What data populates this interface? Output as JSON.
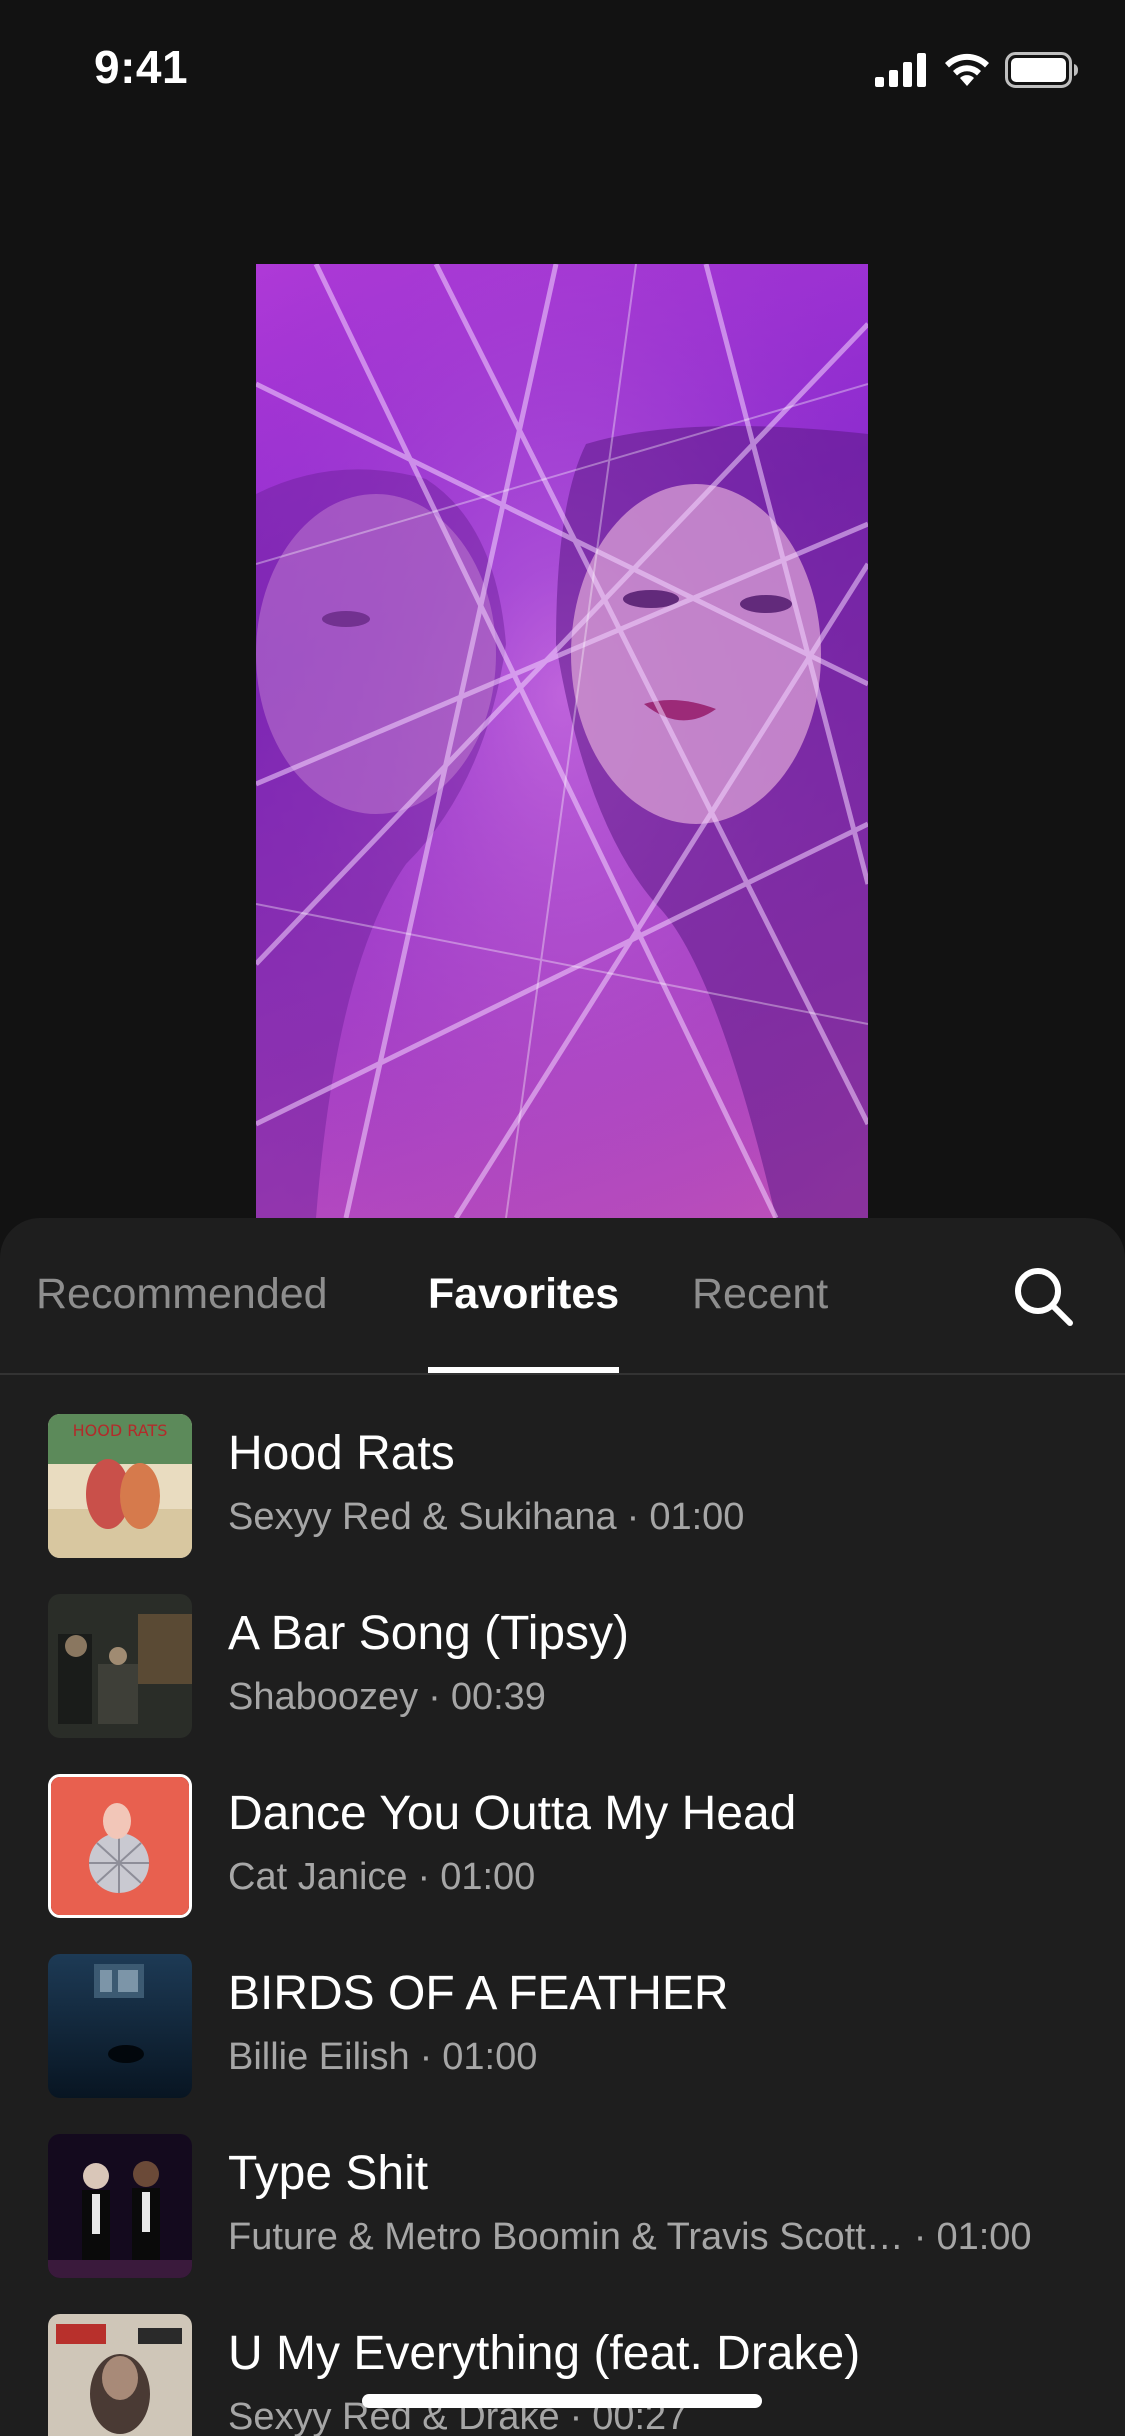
{
  "status_bar": {
    "time": "9:41",
    "icons": [
      "cellular-signal-icon",
      "wifi-icon",
      "battery-icon"
    ]
  },
  "preview": {
    "accent": "#a23ad6"
  },
  "tabs": [
    {
      "label": "Recommended",
      "active": false
    },
    {
      "label": "Favorites",
      "active": true
    },
    {
      "label": "Recent",
      "active": false
    }
  ],
  "search": {
    "icon": "search-icon"
  },
  "songs": [
    {
      "title": "Hood Rats",
      "artist": "Sexyy Red & Sukihana",
      "duration": "01:00"
    },
    {
      "title": "A Bar Song (Tipsy)",
      "artist": "Shaboozey",
      "duration": "00:39"
    },
    {
      "title": "Dance You Outta My Head",
      "artist": "Cat Janice",
      "duration": "01:00"
    },
    {
      "title": "BIRDS OF A FEATHER",
      "artist": "Billie Eilish",
      "duration": "01:00"
    },
    {
      "title": "Type Shit",
      "artist": "Future & Metro Boomin & Travis Scott…",
      "duration": "01:00"
    },
    {
      "title": "U My Everything (feat. Drake)",
      "artist": "Sexyy Red & Drake",
      "duration": "00:27"
    }
  ],
  "colors": {
    "background": "#121212",
    "sheet": "#1e1e1e",
    "text_primary": "#ffffff",
    "text_secondary": "#a6a6a6",
    "tab_inactive": "#8e8e8e"
  }
}
